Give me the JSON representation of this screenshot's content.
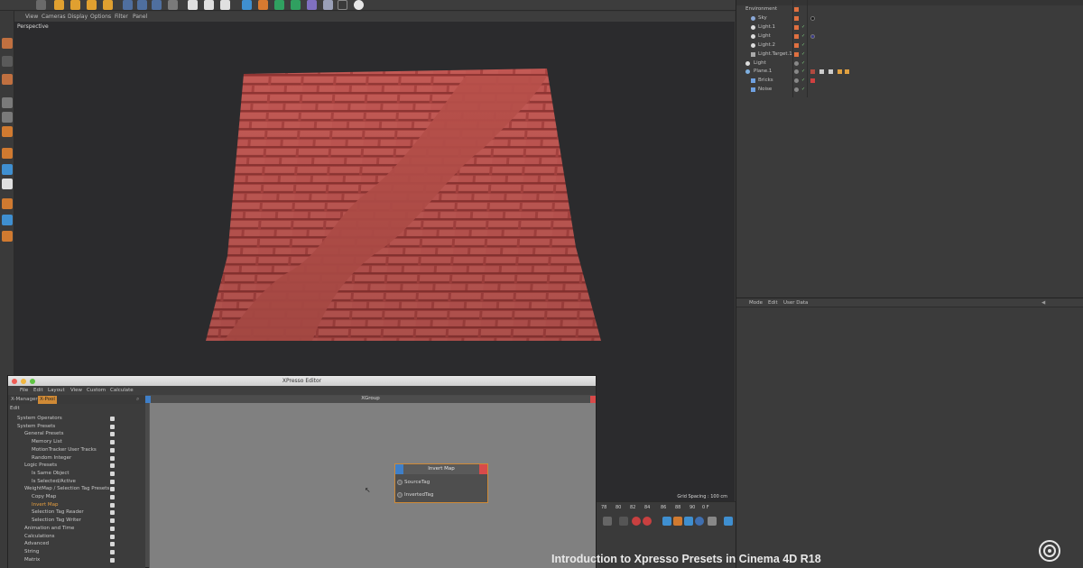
{
  "viewport": {
    "menu": [
      "View",
      "Cameras",
      "Display",
      "Options",
      "Filter",
      "Panel"
    ],
    "label": "Perspective",
    "grid_spacing": "Grid Spacing : 100 cm"
  },
  "object_manager": {
    "objects": [
      {
        "name": "Environment",
        "depth": 0
      },
      {
        "name": "Sky",
        "depth": 1
      },
      {
        "name": "Light.1",
        "depth": 1
      },
      {
        "name": "Light",
        "depth": 1
      },
      {
        "name": "Light.2",
        "depth": 1
      },
      {
        "name": "Light.Target.1",
        "depth": 1
      },
      {
        "name": "Light",
        "depth": 0
      },
      {
        "name": "Plane.1",
        "depth": 0
      },
      {
        "name": "Bricks",
        "depth": 1
      },
      {
        "name": "Noise",
        "depth": 1
      }
    ]
  },
  "attribute_manager": {
    "menu": [
      "Mode",
      "Edit",
      "User Data"
    ]
  },
  "timeline": {
    "frames": [
      "78",
      "80",
      "82",
      "84",
      "86",
      "88",
      "90"
    ],
    "current": "0 F"
  },
  "xpresso": {
    "title": "XPresso Editor",
    "menu": [
      "File",
      "Edit",
      "Layout",
      "View",
      "Custom",
      "Calculate"
    ],
    "tabs": [
      "X-Manager",
      "X-Pool"
    ],
    "active_tab": "X-Pool",
    "edit_label": "Edit",
    "group_title": "XGroup",
    "tree": [
      {
        "label": "System Operators",
        "depth": 0
      },
      {
        "label": "System Presets",
        "depth": 0
      },
      {
        "label": "General Presets",
        "depth": 1
      },
      {
        "label": "Memory List",
        "depth": 2
      },
      {
        "label": "MotionTracker User Tracks",
        "depth": 2
      },
      {
        "label": "Random Integer",
        "depth": 2
      },
      {
        "label": "Logic Presets",
        "depth": 1
      },
      {
        "label": "Is Same Object",
        "depth": 2
      },
      {
        "label": "Is Selected/Active",
        "depth": 2
      },
      {
        "label": "WeightMap / Selection Tag Presets",
        "depth": 1
      },
      {
        "label": "Copy Map",
        "depth": 2
      },
      {
        "label": "Invert Map",
        "depth": 2,
        "selected": true
      },
      {
        "label": "Selection Tag Reader",
        "depth": 2
      },
      {
        "label": "Selection Tag Writer",
        "depth": 2
      },
      {
        "label": "Animation and Time",
        "depth": 1
      },
      {
        "label": "Calculations",
        "depth": 1
      },
      {
        "label": "Advanced",
        "depth": 1
      },
      {
        "label": "String",
        "depth": 1
      },
      {
        "label": "Matrix",
        "depth": 1
      }
    ],
    "node": {
      "title": "Invert Map",
      "ports": [
        "SourceTag",
        "InvertedTag"
      ]
    }
  },
  "caption": "Introduction to Xpresso Presets in Cinema 4D R18",
  "colors": {
    "brick": "#b9504b",
    "accent_orange": "#d08a36",
    "port_blue": "#3f7fc8",
    "port_red": "#d84a4a"
  }
}
